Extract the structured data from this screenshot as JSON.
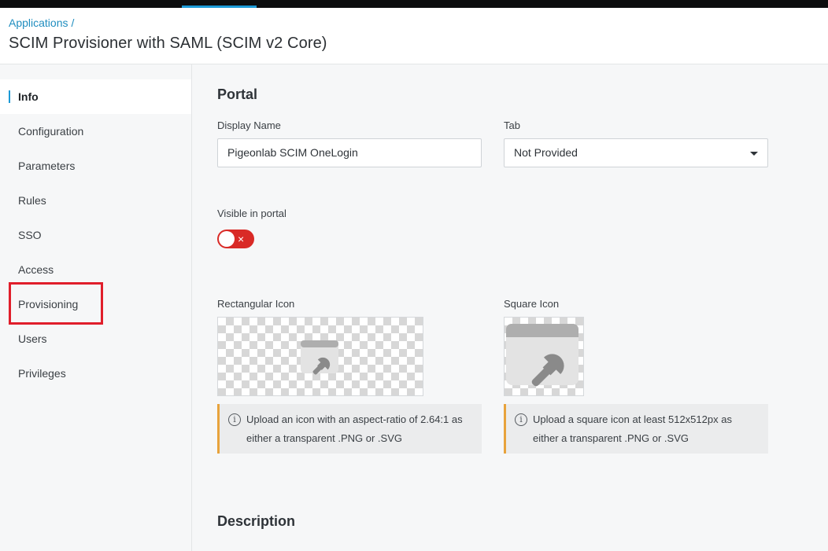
{
  "header": {
    "breadcrumb": "Applications",
    "breadcrumb_sep": "/",
    "title": "SCIM Provisioner with SAML (SCIM v2 Core)"
  },
  "sidebar": {
    "items": [
      {
        "label": "Info",
        "active": true
      },
      {
        "label": "Configuration"
      },
      {
        "label": "Parameters"
      },
      {
        "label": "Rules"
      },
      {
        "label": "SSO"
      },
      {
        "label": "Access"
      },
      {
        "label": "Provisioning",
        "highlighted": true
      },
      {
        "label": "Users"
      },
      {
        "label": "Privileges"
      }
    ]
  },
  "portal": {
    "title": "Portal",
    "display_name_label": "Display Name",
    "display_name_value": "Pigeonlab SCIM OneLogin",
    "tab_label": "Tab",
    "tab_value": "Not Provided",
    "visible_label": "Visible in portal",
    "visible_toggle_symbol": "×",
    "rect_icon_label": "Rectangular Icon",
    "square_icon_label": "Square Icon",
    "rect_info": "Upload an icon with an aspect-ratio of 2.64:1 as either a transparent .PNG or .SVG",
    "square_info": "Upload a square icon at least 512x512px as either a transparent .PNG or .SVG",
    "info_glyph": "i"
  },
  "description": {
    "title": "Description"
  },
  "colors": {
    "accent": "#1c9ad6",
    "toggle_off": "#d92a26",
    "highlight": "#e01e2b",
    "info_border": "#e8a33c"
  }
}
